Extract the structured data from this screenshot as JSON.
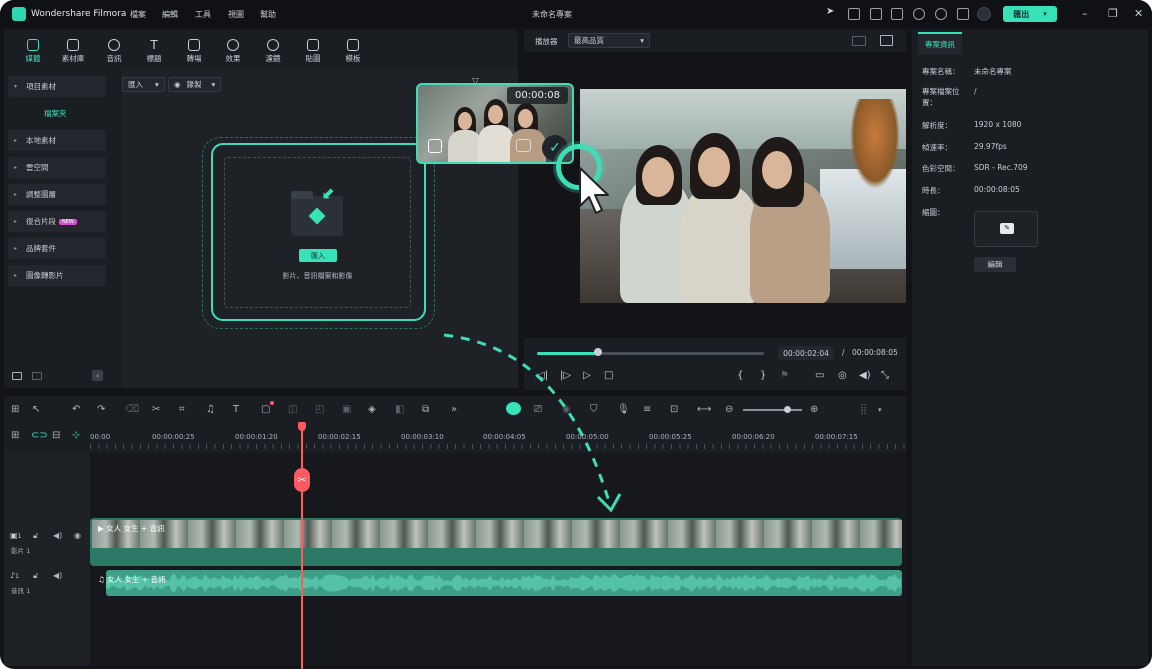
{
  "titlebar": {
    "app_name": "Wondershare Filmora",
    "menus": [
      "檔案",
      "編輯",
      "工具",
      "視圖",
      "幫助"
    ],
    "project_title": "未命名專案",
    "export_label": "匯出"
  },
  "media_tabs": [
    "媒體",
    "素材庫",
    "音訊",
    "標題",
    "轉場",
    "效果",
    "濾鏡",
    "貼圖",
    "模板"
  ],
  "sidebar": {
    "items": [
      {
        "label": "項目素材",
        "new": false
      },
      {
        "label": "檔案夾",
        "sub": true
      },
      {
        "label": "本地素材",
        "new": false
      },
      {
        "label": "雲空間",
        "new": false
      },
      {
        "label": "調整圖層",
        "new": false
      },
      {
        "label": "復合片段",
        "new": true
      },
      {
        "label": "品牌套件",
        "new": false
      },
      {
        "label": "圖像轉影片",
        "new": false
      }
    ],
    "new_badge": "NEW"
  },
  "media": {
    "import_dropdown": "匯入",
    "record_dropdown": "錄製",
    "import_button": "匯入",
    "import_hint": "影片、音訊檔案和影像",
    "thumb_timecode": "00:00:08"
  },
  "player": {
    "label": "播放器",
    "quality": "最高品質",
    "current_time": "00:00:02:04",
    "separator": "/",
    "total_time": "00:00:08:05",
    "progress_percent": 27
  },
  "info": {
    "tab": "專案資訊",
    "rows": [
      {
        "label": "專案名稱：",
        "value": "未命名專案"
      },
      {
        "label": "專案檔案位置：",
        "value": "/"
      },
      {
        "label": "解析度：",
        "value": "1920 x 1080"
      },
      {
        "label": "幀速率：",
        "value": "29.97fps"
      },
      {
        "label": "色彩空間：",
        "value": "SDR - Rec.709"
      },
      {
        "label": "時長：",
        "value": "00:00:08:05"
      },
      {
        "label": "縮圖：",
        "value": ""
      }
    ],
    "edit_button": "編輯"
  },
  "timeline": {
    "ruler": [
      "00:00",
      "00:00:00:25",
      "00:00:01:20",
      "00:00:02:15",
      "00:00:03:10",
      "00:00:04:05",
      "00:00:05:00",
      "00:00:05:25",
      "00:00:06:20",
      "00:00:07:15"
    ],
    "video_track_label": "影片 1",
    "audio_track_label": "音訊 1",
    "video_clip_name": "女人 女生 + 音訊",
    "audio_clip_name": "女人 女生 + 音訊",
    "track_video_num": "1",
    "track_audio_num": "1"
  },
  "colors": {
    "accent": "#37e2b8",
    "playhead": "#ff5a5f",
    "bg": "#121418"
  }
}
